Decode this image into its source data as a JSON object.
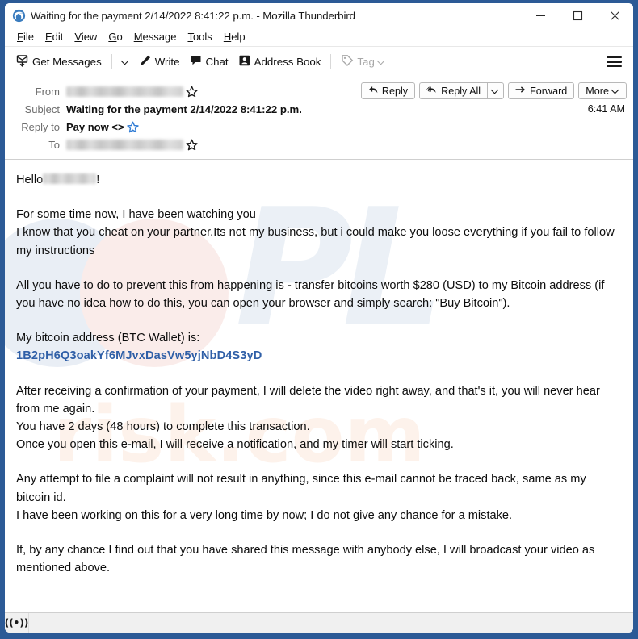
{
  "window": {
    "title": "Waiting for the payment 2/14/2022 8:41:22 p.m. - Mozilla Thunderbird",
    "app_icon": "thunderbird-icon",
    "controls": {
      "minimize": "minimize-icon",
      "maximize": "maximize-icon",
      "close": "close-icon"
    },
    "frame_color": "#2c5a96"
  },
  "menubar": {
    "items": [
      {
        "label": "File",
        "accesskey": "F"
      },
      {
        "label": "Edit",
        "accesskey": "E"
      },
      {
        "label": "View",
        "accesskey": "V"
      },
      {
        "label": "Go",
        "accesskey": "G"
      },
      {
        "label": "Message",
        "accesskey": "M"
      },
      {
        "label": "Tools",
        "accesskey": "T"
      },
      {
        "label": "Help",
        "accesskey": "H"
      }
    ]
  },
  "toolbar": {
    "get_messages": "Get Messages",
    "get_messages_icon": "download-mail-icon",
    "get_messages_dropdown": "chevron-down-icon",
    "write": "Write",
    "write_icon": "pencil-icon",
    "chat": "Chat",
    "chat_icon": "speech-bubble-icon",
    "address_book": "Address Book",
    "address_book_icon": "contact-card-icon",
    "tag": "Tag",
    "tag_icon": "tag-icon",
    "tag_dropdown": "chevron-down-icon",
    "tag_disabled": true,
    "app_menu_icon": "hamburger-menu-icon"
  },
  "message_header": {
    "from_label": "From",
    "from_value_redacted": true,
    "from_star_icon": "star-outline-icon",
    "subject_label": "Subject",
    "subject_value": "Waiting for the payment 2/14/2022 8:41:22 p.m.",
    "reply_to_label": "Reply to",
    "reply_to_value": "Pay now <>",
    "reply_to_star_icon": "star-filled-blue-icon",
    "to_label": "To",
    "to_value_redacted": true,
    "to_star_icon": "star-outline-icon",
    "time": "6:41 AM",
    "actions": {
      "reply": "Reply",
      "reply_icon": "reply-arrow-icon",
      "reply_all": "Reply All",
      "reply_all_icon": "reply-all-arrow-icon",
      "reply_all_dropdown": "chevron-down-icon",
      "forward": "Forward",
      "forward_icon": "forward-arrow-icon",
      "more": "More",
      "more_dropdown": "chevron-down-icon"
    }
  },
  "body": {
    "greeting_prefix": "Hello",
    "greeting_suffix": "!",
    "greeting_redacted": true,
    "paragraph_2": [
      "For some time now, I have been watching you",
      "I know that you cheat on your partner.Its not my business, but i could make you loose everything if you fail to follow my instructions"
    ],
    "paragraph_3": [
      "All you have to do to prevent this from happening is - transfer bitcoins worth $280 (USD) to my Bitcoin address (if you have no idea how to do this, you can open your browser and simply search: \"Buy Bitcoin\")."
    ],
    "paragraph_4_label": "My bitcoin address (BTC Wallet) is:",
    "bitcoin_address": "1B2pH6Q3oakYf6MJvxDasVw5yjNbD4S3yD",
    "bitcoin_address_color": "#2f5fa7",
    "paragraph_5": [
      "After receiving a confirmation of your payment, I will delete the video right away, and that's it, you will never hear from me again.",
      "You have 2 days (48 hours) to complete this transaction.",
      "Once you open this e-mail, I will receive a notification, and my timer will start ticking."
    ],
    "paragraph_6": [
      "Any attempt to file a complaint will not result in anything, since this e-mail cannot be traced back, same as my bitcoin id.",
      "I have been working on this for a very long time by now; I do not give any chance for a mistake."
    ],
    "paragraph_7": [
      "If, by any chance I find out that you have shared this message with anybody else, I will broadcast your video as mentioned above."
    ],
    "watermark_text": "risk.com"
  },
  "statusbar": {
    "online_icon": "broadcast-online-icon",
    "online_glyph": "((•))"
  }
}
